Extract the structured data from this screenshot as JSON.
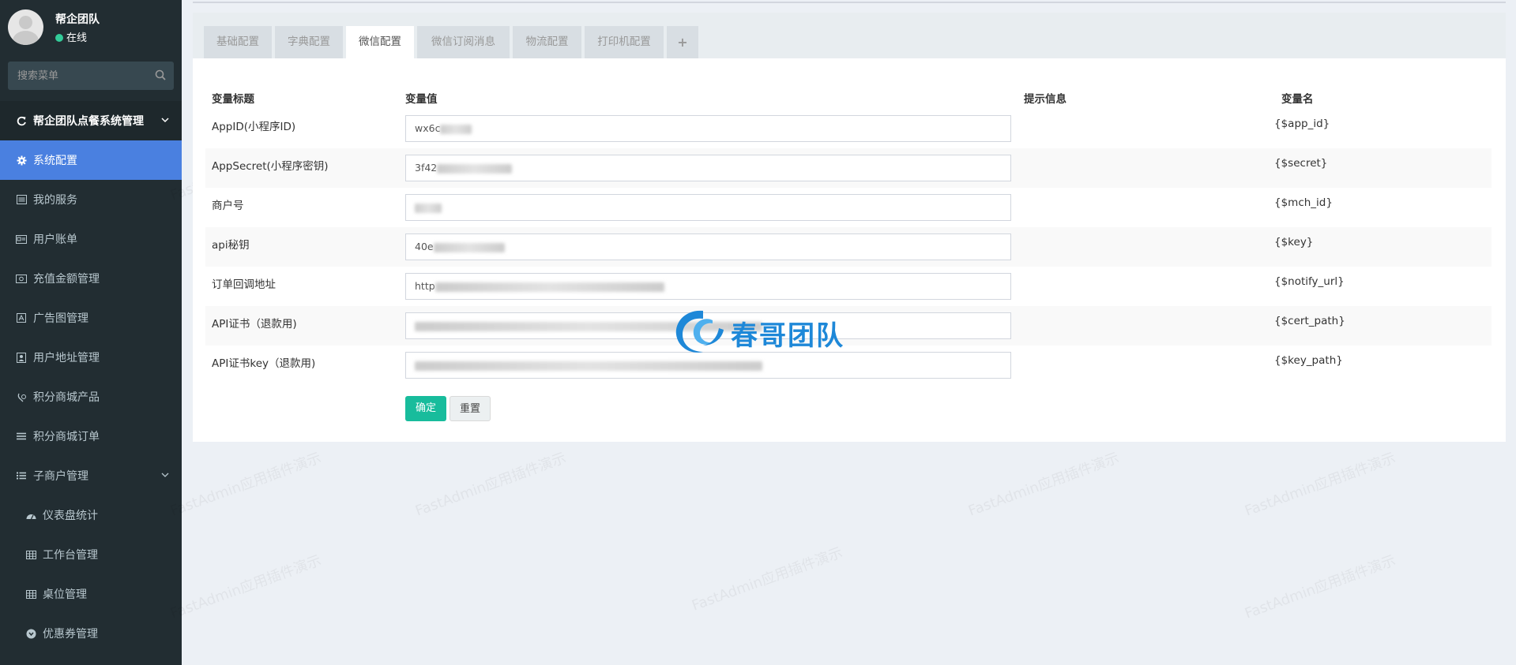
{
  "user": {
    "name": "帮企团队",
    "status": "在线"
  },
  "search": {
    "placeholder": "搜索菜单"
  },
  "menu": {
    "header": "帮企团队点餐系统管理",
    "items": [
      {
        "label": "系统配置",
        "icon": "gear-icon",
        "active": true
      },
      {
        "label": "我的服务",
        "icon": "list-icon"
      },
      {
        "label": "用户账单",
        "icon": "card-icon"
      },
      {
        "label": "充值金额管理",
        "icon": "money-icon"
      },
      {
        "label": "广告图管理",
        "icon": "image-icon"
      },
      {
        "label": "用户地址管理",
        "icon": "address-icon"
      },
      {
        "label": "积分商城产品",
        "icon": "gift-icon"
      },
      {
        "label": "积分商城订单",
        "icon": "bars-icon"
      },
      {
        "label": "子商户管理",
        "icon": "list-icon"
      }
    ],
    "subitems": [
      {
        "label": "仪表盘统计",
        "icon": "dashboard-icon"
      },
      {
        "label": "工作台管理",
        "icon": "table-icon"
      },
      {
        "label": "桌位管理",
        "icon": "table-icon"
      },
      {
        "label": "优惠券管理",
        "icon": "coupon-icon"
      }
    ]
  },
  "tabs": [
    "基础配置",
    "字典配置",
    "微信配置",
    "微信订阅消息",
    "物流配置",
    "打印机配置",
    "+"
  ],
  "table": {
    "headers": {
      "title": "变量标题",
      "value": "变量值",
      "tip": "提示信息",
      "name": "变量名"
    },
    "rows": [
      {
        "title": "AppID(小程序ID)",
        "value": "wx6c",
        "var": "{$app_id}"
      },
      {
        "title": "AppSecret(小程序密钥)",
        "value": "3f42",
        "var": "{$secret}"
      },
      {
        "title": "商户号",
        "value": "",
        "var": "{$mch_id}"
      },
      {
        "title": "api秘钥",
        "value": "40e",
        "var": "{$key}"
      },
      {
        "title": "订单回调地址",
        "value": "http",
        "var": "{$notify_url}"
      },
      {
        "title": "API证书（退款用)",
        "value": "",
        "var": "{$cert_path}"
      },
      {
        "title": "API证书key（退款用)",
        "value": "",
        "var": "{$key_path}"
      }
    ]
  },
  "buttons": {
    "ok": "确定",
    "reset": "重置"
  },
  "overlay_logo": "春哥团队",
  "watermark": "FastAdmin应用插件演示",
  "colors": {
    "sidebar": "#222d32",
    "active": "#4a80e0",
    "ok": "#18bc9c",
    "logo": "#1e88d8"
  }
}
